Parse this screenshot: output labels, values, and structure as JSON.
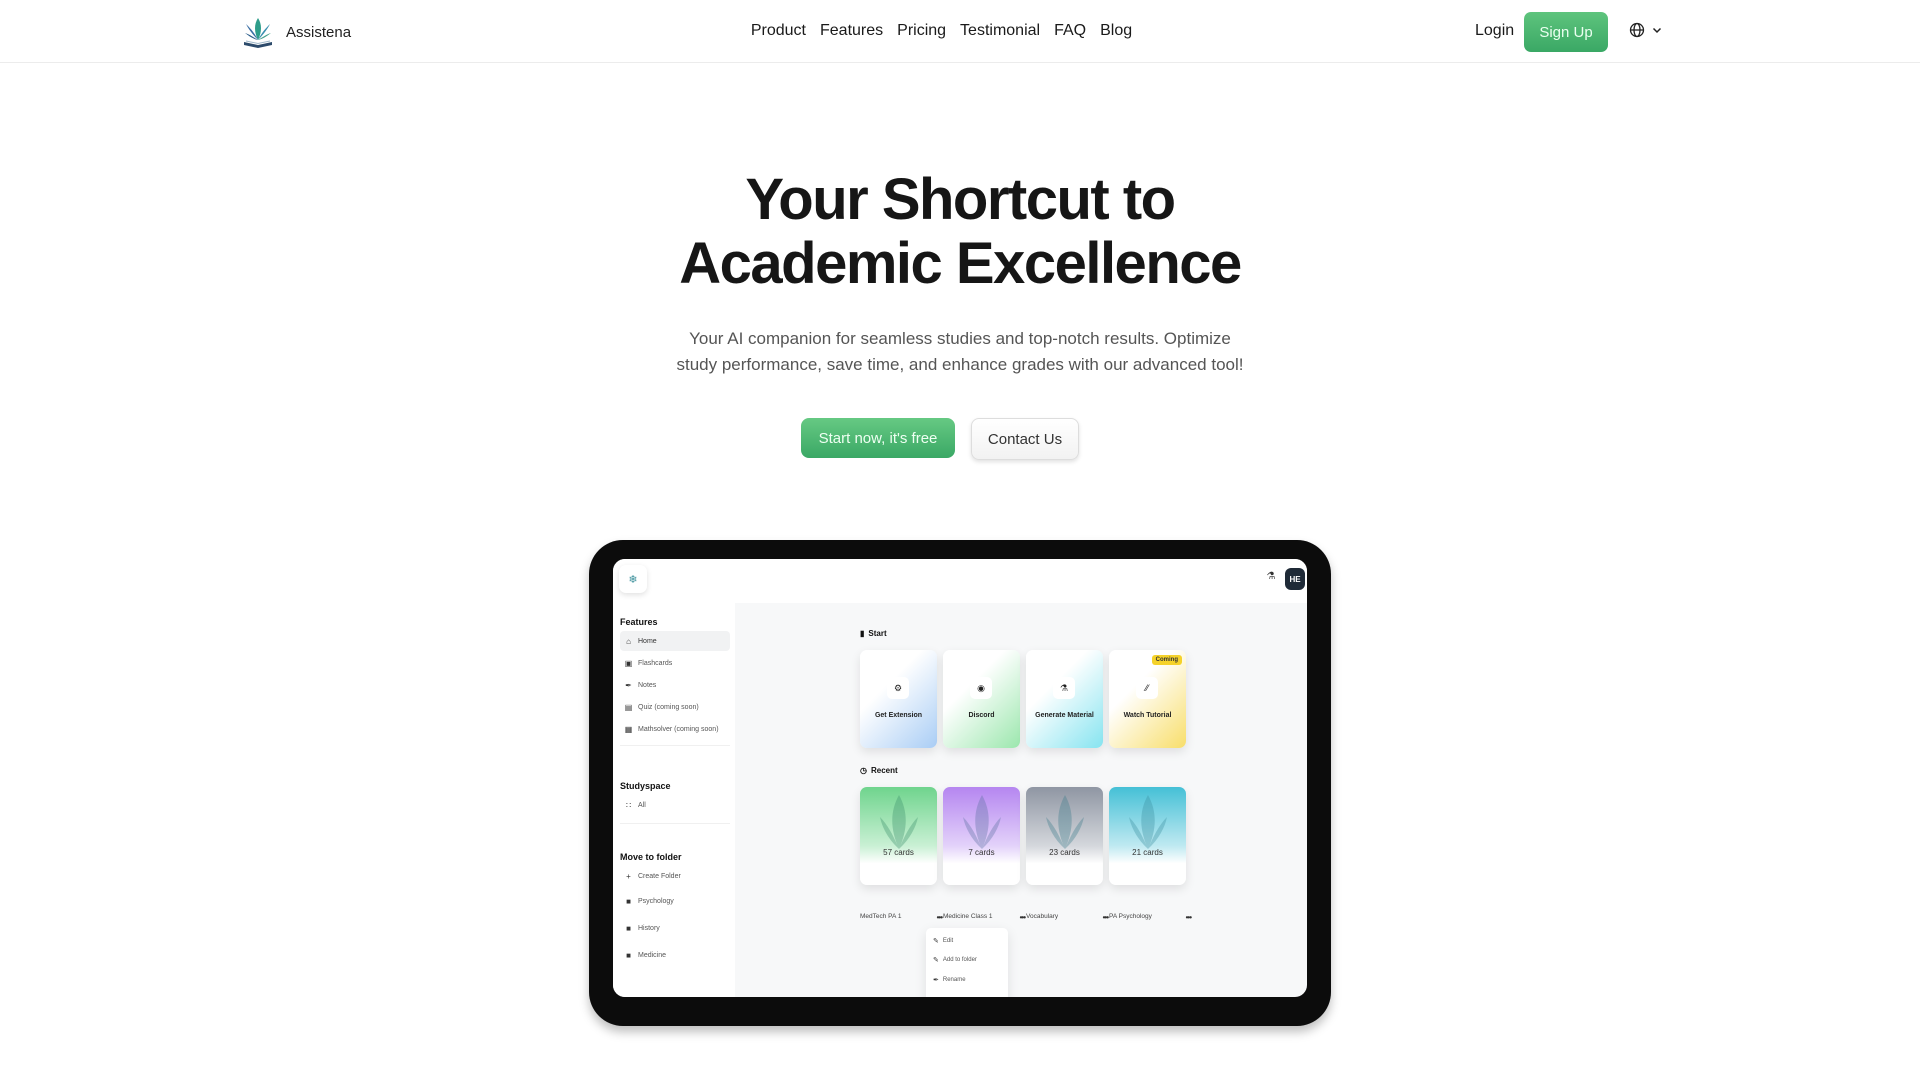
{
  "brand": {
    "name": "Assistena",
    "accent": "#3aa865"
  },
  "nav": {
    "links": [
      "Product",
      "Features",
      "Pricing",
      "Testimonial",
      "FAQ",
      "Blog"
    ],
    "login": "Login",
    "signup": "Sign Up",
    "language_icon": "globe-icon"
  },
  "hero": {
    "title_line1": "Your Shortcut to",
    "title_line2": "Academic Excellence",
    "subtitle_line1": "Your AI companion for seamless studies and top-notch results. Optimize",
    "subtitle_line2": "study performance, save time, and enhance grades with our advanced tool!",
    "primary_cta": "Start now, it's free",
    "secondary_cta": "Contact Us"
  },
  "app_preview": {
    "avatar": "HE",
    "sidebar": {
      "features_heading": "Features",
      "features": [
        {
          "label": "Home",
          "icon": "home-icon",
          "active": true
        },
        {
          "label": "Flashcards",
          "icon": "flashcards-icon"
        },
        {
          "label": "Notes",
          "icon": "pen-icon"
        },
        {
          "label": "Quiz (coming soon)",
          "icon": "quiz-icon"
        },
        {
          "label": "Mathsolver (coming soon)",
          "icon": "calculator-icon"
        }
      ],
      "studyspace_heading": "Studyspace",
      "studyspace": [
        {
          "label": "All",
          "icon": "grid-icon"
        }
      ],
      "folder_heading": "Move to folder",
      "folders": [
        {
          "label": "Create Folder",
          "icon": "plus-icon"
        },
        {
          "label": "Psychology",
          "icon": "folder-icon"
        },
        {
          "label": "History",
          "icon": "folder-icon"
        },
        {
          "label": "Medicine",
          "icon": "folder-icon"
        }
      ]
    },
    "start": {
      "heading": "Start",
      "cards": [
        {
          "label": "Get Extension",
          "icon": "puzzle-icon"
        },
        {
          "label": "Discord",
          "icon": "discord-icon"
        },
        {
          "label": "Generate Material",
          "icon": "flask-icon"
        },
        {
          "label": "Watch Tutorial",
          "icon": "tutorial-icon",
          "badge": "Coming"
        }
      ]
    },
    "recent": {
      "heading": "Recent",
      "decks": [
        {
          "name": "MedTech PA 1",
          "count": "57 cards"
        },
        {
          "name": "Medicine Class 1",
          "count": "7 cards"
        },
        {
          "name": "Vocabulary",
          "count": "23 cards"
        },
        {
          "name": "PA Psychology",
          "count": "21 cards"
        }
      ]
    },
    "context_menu": [
      "Edit",
      "Add to folder",
      "Rename"
    ]
  }
}
